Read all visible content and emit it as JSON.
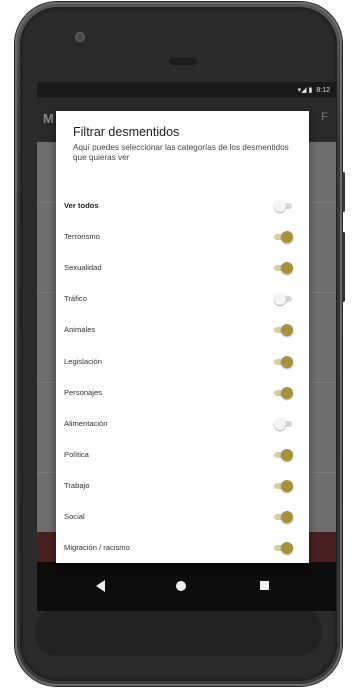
{
  "status_bar": {
    "time": "8:12",
    "signal_icons": "▾◢ ▮"
  },
  "app_bar": {
    "title_fragment": "M",
    "action_fragment": "F"
  },
  "dialog": {
    "title": "Filtrar desmentidos",
    "description": "Aquí puedes seleccionar las categorías de los desmentidos que quieras ver",
    "options": [
      {
        "label": "Ver todos",
        "on": false,
        "bold": true
      },
      {
        "label": "Terrorismo",
        "on": true
      },
      {
        "label": "Sexualidad",
        "on": true
      },
      {
        "label": "Tráfico",
        "on": false
      },
      {
        "label": "Animales",
        "on": true
      },
      {
        "label": "Legislación",
        "on": true
      },
      {
        "label": "Personajes",
        "on": true
      },
      {
        "label": "Alimentación",
        "on": false
      },
      {
        "label": "Política",
        "on": true
      },
      {
        "label": "Trabajo",
        "on": true
      },
      {
        "label": "Social",
        "on": true
      },
      {
        "label": "Migración / racismo",
        "on": true
      }
    ]
  },
  "nav_bar": {
    "back_icon": "back-triangle-icon",
    "home_icon": "home-circle-icon",
    "recents_icon": "recents-square-icon"
  },
  "colors": {
    "switch_on": "#a8913a",
    "switch_track_on": "#d6cfa0",
    "switch_off_track": "#d8d8d8"
  }
}
